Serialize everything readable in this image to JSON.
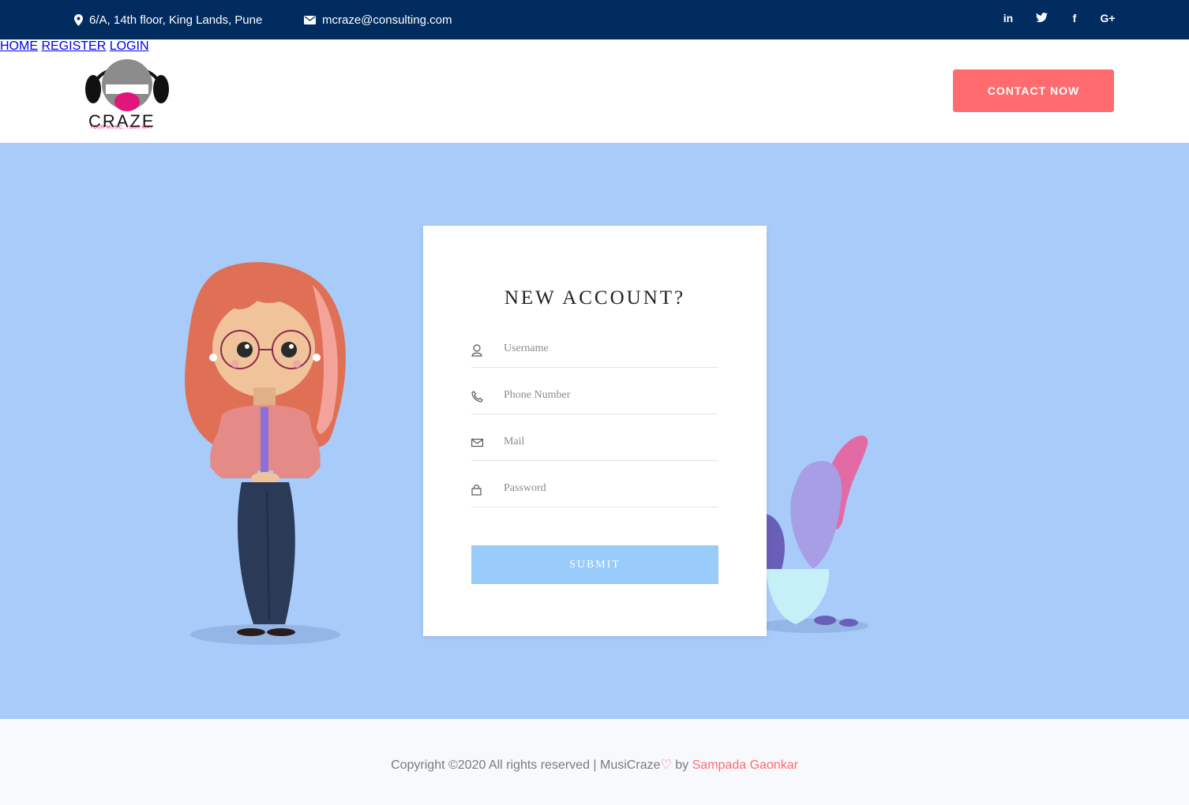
{
  "topbar": {
    "address": "6/A, 14th floor, King Lands, Pune",
    "email": "mcraze@consulting.com",
    "social": [
      "in",
      "t",
      "f",
      "G+"
    ]
  },
  "logo": {
    "brand": "CRAZE",
    "tagline": "YOUR MUSIC, YOUR WAY"
  },
  "nav": {
    "home": "HOME",
    "register": "REGISTER",
    "login": "LOGIN",
    "contact": "CONTACT NOW"
  },
  "form": {
    "title": "NEW ACCOUNT?",
    "username_placeholder": "Username",
    "phone_placeholder": "Phone Number",
    "mail_placeholder": "Mail",
    "password_placeholder": "Password",
    "submit": "SUBMIT"
  },
  "footer": {
    "copyright": "Copyright ©2020 All rights reserved | MusiCraze",
    "heart": "♡",
    "by": " by ",
    "author": "Sampada Gaonkar"
  },
  "colors": {
    "topbar": "#002c5f",
    "accent": "#ff6b6f",
    "hero_bg": "#a9cbfa",
    "submit_bg": "#99cbfb"
  },
  "icons": {
    "address": "map-pin-icon",
    "email": "envelope-icon",
    "username": "user-icon",
    "phone": "phone-icon",
    "mail": "mail-icon",
    "password": "lock-icon"
  }
}
